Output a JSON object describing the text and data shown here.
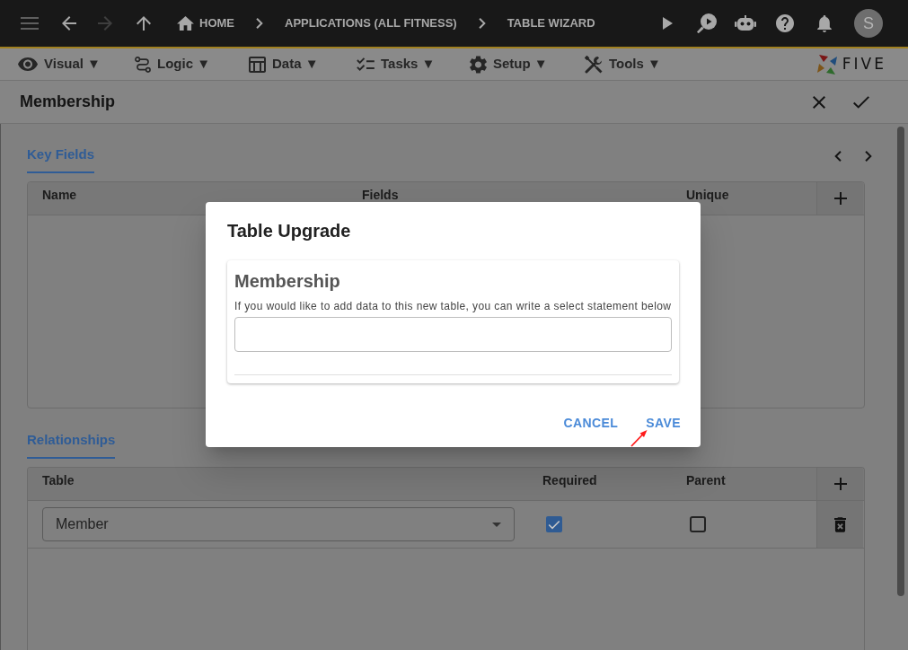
{
  "top_bar": {
    "nav_buttons": [
      {
        "kind": "back",
        "disabled": false
      },
      {
        "kind": "forward",
        "disabled": true
      },
      {
        "kind": "up",
        "disabled": false
      }
    ],
    "breadcrumbs": [
      {
        "label": "HOME"
      },
      {
        "label": "APPLICATIONS (ALL FITNESS)"
      },
      {
        "label": "TABLE WIZARD"
      }
    ],
    "avatar": "S"
  },
  "menu_bar": {
    "items": [
      {
        "label": "Visual ▼"
      },
      {
        "label": "Logic ▼"
      },
      {
        "label": "Data ▼"
      },
      {
        "label": "Tasks ▼"
      },
      {
        "label": "Setup ▼"
      },
      {
        "label": "Tools ▼"
      }
    ],
    "logo": "FIVE"
  },
  "form": {
    "title": "Membership"
  },
  "key_fields": {
    "tab": {
      "label": "Key Fields",
      "selected": true
    },
    "columns": [
      "Name",
      "Fields",
      "Unique"
    ]
  },
  "relationships": {
    "tab": {
      "label": "Relationships",
      "selected": true
    },
    "columns": [
      "Table",
      "Required",
      "Parent"
    ],
    "rows": [
      {
        "table": "Member",
        "required": true,
        "parent": false
      }
    ]
  },
  "dialog": {
    "title": "Table Upgrade",
    "card_title": "Membership",
    "description": "If you would like to add data to this new table, you can write a select statement below",
    "buttons": [
      {
        "label": "CANCEL"
      },
      {
        "label": "SAVE"
      }
    ]
  }
}
